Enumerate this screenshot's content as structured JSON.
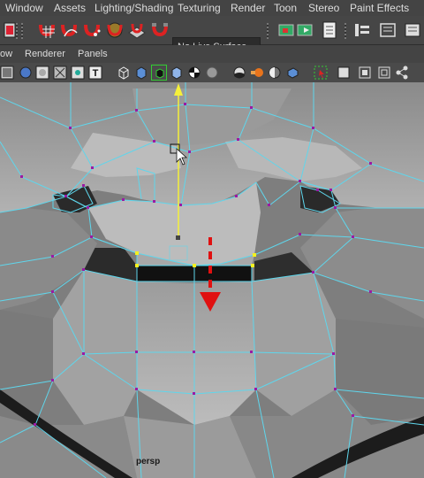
{
  "menubar": {
    "items": [
      "Window",
      "Assets",
      "Lighting/Shading",
      "Texturing",
      "Render",
      "Toon",
      "Stereo",
      "Paint Effects"
    ]
  },
  "toolbar": {
    "live_surface_label": "No Live Surface",
    "icons": [
      "select-by-hierarchy-icon",
      "snap-to-grids-icon",
      "snap-to-curves-icon",
      "snap-to-points-icon",
      "snap-to-view-planes-icon",
      "make-live-icon",
      "history-icon",
      "render-current-frame-icon",
      "ipr-render-icon",
      "render-settings-icon",
      "attribute-editor-icon",
      "tool-settings-icon",
      "channel-box-icon"
    ]
  },
  "panel_menu": {
    "items": [
      "ow",
      "Renderer",
      "Panels"
    ]
  },
  "viewport": {
    "camera_label": "persp"
  },
  "colors": {
    "wire": "#5fd6ec",
    "vertex": "#9b1aa5",
    "selected_vertex": "#f3f020",
    "move_y_axis": "#f5f03a",
    "drag_arrow": "#e01010"
  }
}
